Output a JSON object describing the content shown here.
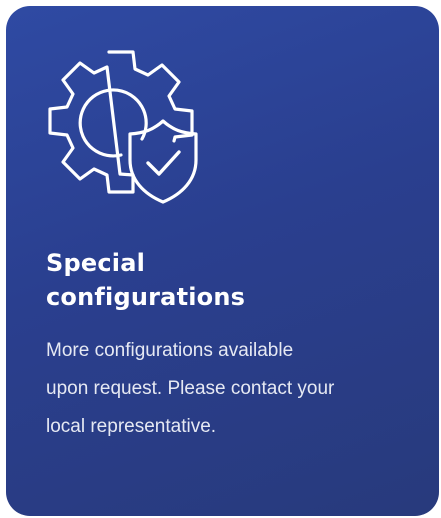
{
  "card": {
    "icon": "gear-with-shield-check-icon",
    "title_line1": "Special",
    "title_line2": "configurations",
    "description_line1": "More configurations available",
    "description_line2": "upon request. Please contact your",
    "description_line3": "local representative.",
    "colors": {
      "background_start": "#2f4aa3",
      "background_end": "#283a7c",
      "text": "#ffffff"
    }
  }
}
